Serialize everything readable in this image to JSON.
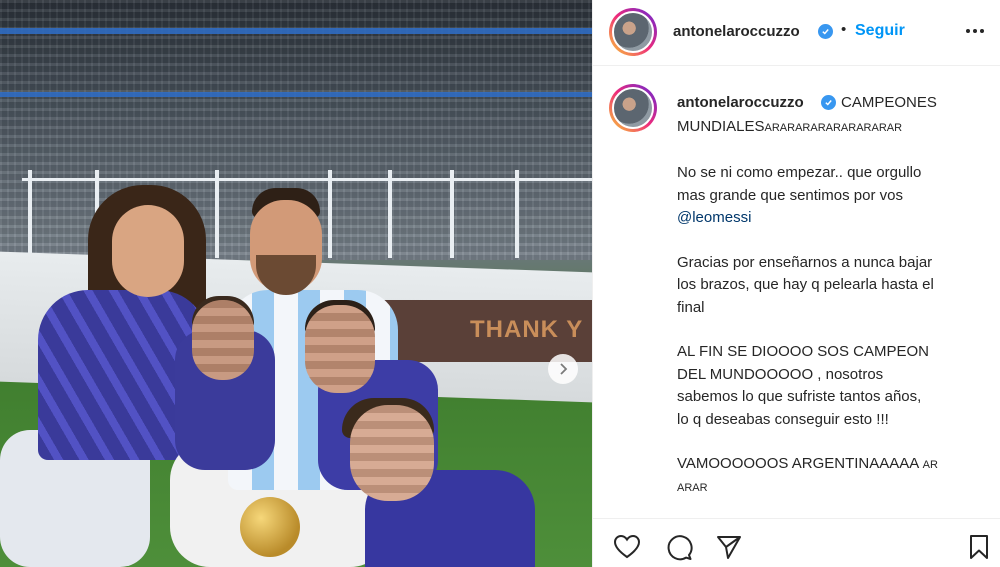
{
  "post": {
    "username": "antonelaroccuzzo",
    "separator": "•",
    "follow_label": "Seguir"
  },
  "photo": {
    "banner_text": "THANK Y"
  },
  "caption": {
    "username": "antonelaroccuzzo",
    "line1_rest": "CAMPEONES",
    "line2_main": "MUNDIALES",
    "line2_small": "ARARARARARARARARAR",
    "para1_lines": [
      "No se ni como empezar.. que orgullo",
      "mas grande que sentimos por vos"
    ],
    "para1_mention": "@leomessi",
    "para2_lines": [
      "Gracias por enseñarnos a nunca bajar",
      "los brazos, que hay q pelearla hasta el",
      "final"
    ],
    "para3_lines": [
      "AL FIN SE DIOOOO SOS CAMPEON",
      "DEL MUNDOOOOO , nosotros",
      "sabemos lo que sufriste tantos años,",
      "lo q deseabas conseguir esto !!!"
    ],
    "para4_main": "VAMOOOOOOS ARGENTINAAAAA",
    "para4_small1": "AR",
    "para4_small2": "ARAR",
    "fade_text": "· · ·"
  },
  "icons": {
    "verified": "verified-badge-icon",
    "more": "more-options-icon",
    "next": "chevron-right-icon",
    "like": "heart-icon",
    "comment": "comment-icon",
    "share": "send-icon",
    "save": "bookmark-icon"
  },
  "colors": {
    "follow_blue": "#0095f6",
    "verified_blue": "#3897f0",
    "mention": "#00376b",
    "text": "#262626"
  }
}
